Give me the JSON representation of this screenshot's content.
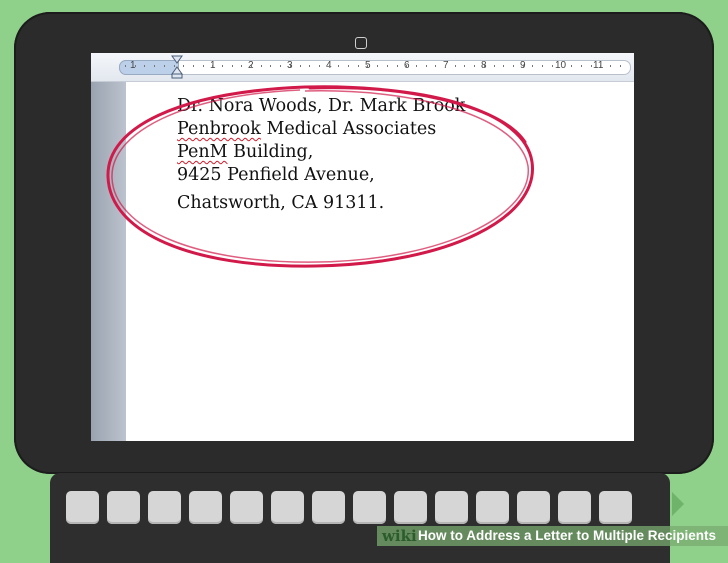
{
  "document": {
    "address_lines": [
      "Dr. Nora Woods, Dr. Mark Brook",
      "Medical Associates",
      "Building,",
      "9425 Penfield Avenue,",
      "Chatsworth, CA 91311."
    ],
    "misspelled_words": [
      "Penbrook",
      "PenM"
    ]
  },
  "ruler": {
    "labels": [
      "1",
      "1",
      "2",
      "3",
      "4",
      "5",
      "6",
      "7",
      "8",
      "9",
      "10",
      "11"
    ]
  },
  "watermark": {
    "logo": "wiki",
    "title": "How to Address a Letter to Multiple Recipients"
  },
  "colors": {
    "background": "#8fd18a",
    "laptop": "#2b2b2b",
    "circle": "#d11a4a",
    "spellcheck": "#d11a2a"
  },
  "icons": [
    "webcam-icon",
    "indent-marker-icon",
    "next-arrow-icon"
  ]
}
